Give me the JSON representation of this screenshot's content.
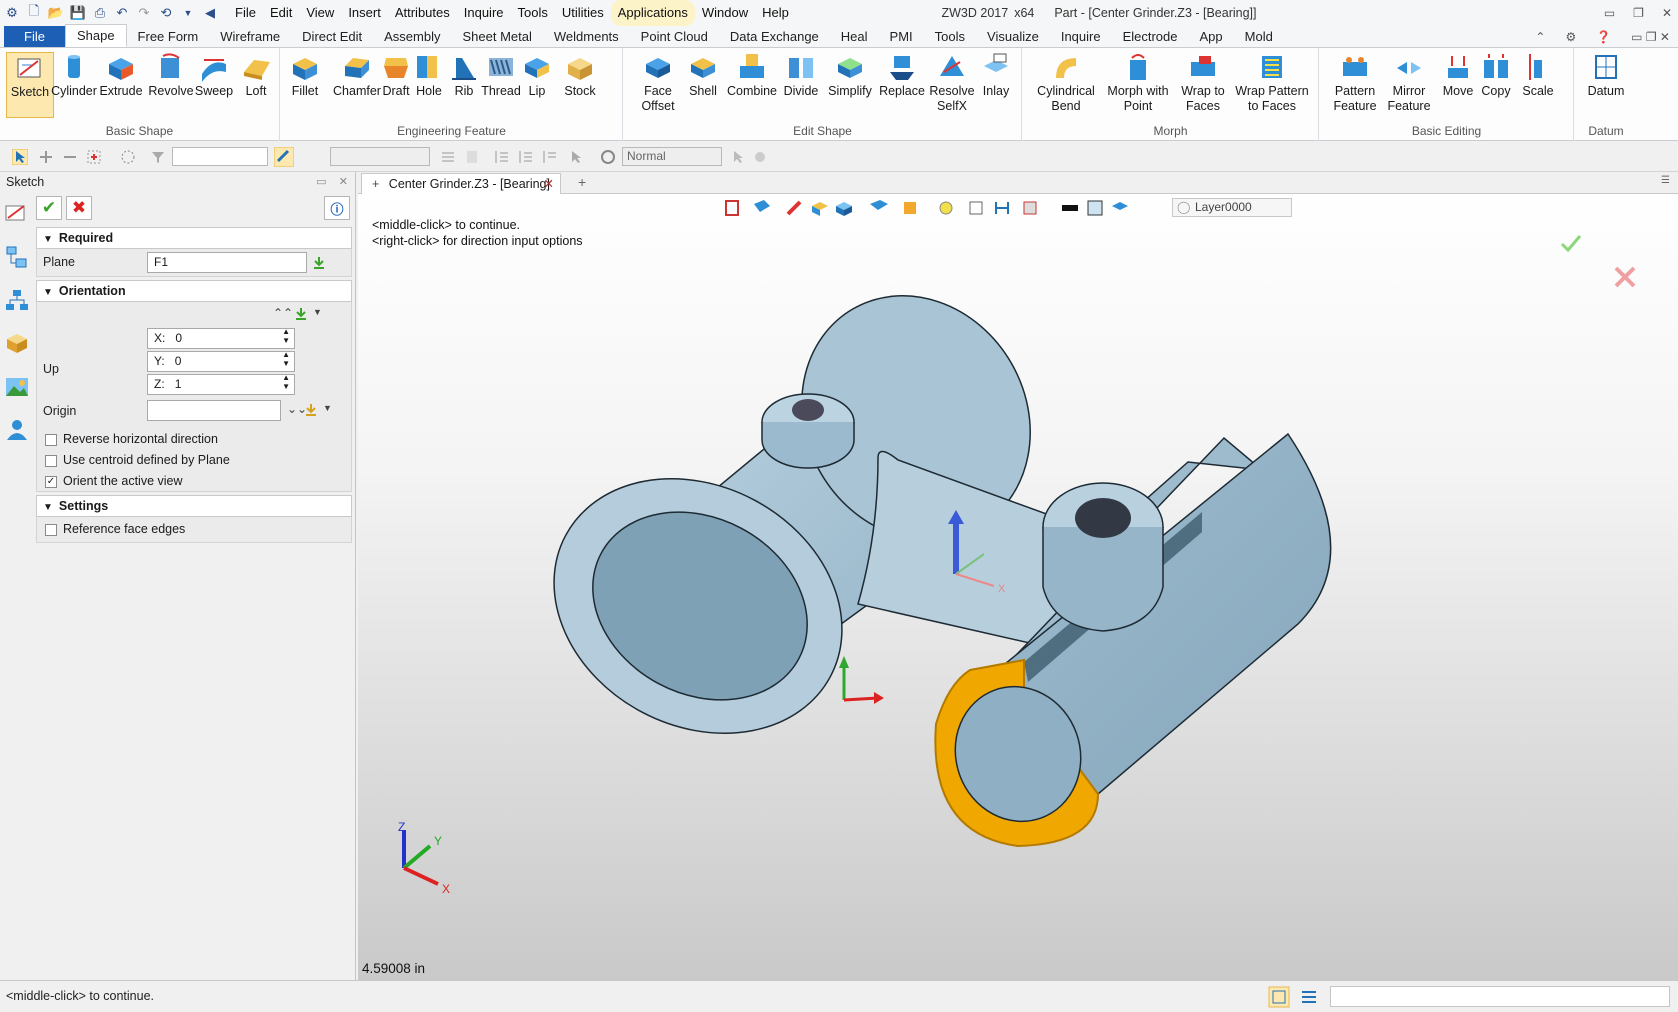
{
  "titlebar": {
    "app": "ZW3D 2017",
    "arch": "x64",
    "doc": "Part - [Center Grinder.Z3 - [Bearing]]"
  },
  "menu": [
    "File",
    "Edit",
    "View",
    "Insert",
    "Attributes",
    "Inquire",
    "Tools",
    "Utilities",
    "Applications",
    "Window",
    "Help"
  ],
  "ribbon_tabs": [
    "File",
    "Shape",
    "Free Form",
    "Wireframe",
    "Direct Edit",
    "Assembly",
    "Sheet Metal",
    "Weldments",
    "Point Cloud",
    "Data Exchange",
    "Heal",
    "PMI",
    "Tools",
    "Visualize",
    "Inquire",
    "Electrode",
    "App",
    "Mold"
  ],
  "active_tab": "Shape",
  "groups": {
    "basic_shape": {
      "title": "Basic Shape",
      "items": [
        "Sketch",
        "Cylinder",
        "Extrude",
        "Revolve",
        "Sweep",
        "Loft"
      ]
    },
    "engineering": {
      "title": "Engineering Feature",
      "items": [
        "Fillet",
        "Chamfer",
        "Draft",
        "Hole",
        "Rib",
        "Thread",
        "Lip",
        "Stock"
      ]
    },
    "edit_shape": {
      "title": "Edit Shape",
      "items": [
        "Face Offset",
        "Shell",
        "Combine",
        "Divide",
        "Simplify",
        "Replace",
        "Resolve SelfX",
        "Inlay"
      ]
    },
    "morph": {
      "title": "Morph",
      "items": [
        "Cylindrical Bend",
        "Morph with Point",
        "Wrap to Faces",
        "Wrap Pattern to Faces"
      ]
    },
    "basic_editing": {
      "title": "Basic Editing",
      "items": [
        "Pattern Feature",
        "Mirror Feature",
        "Move",
        "Copy",
        "Scale"
      ]
    },
    "datum": {
      "title": "Datum",
      "items": [
        "Datum"
      ]
    }
  },
  "toolbar2": {
    "render_mode": "Normal"
  },
  "panel": {
    "title": "Sketch",
    "required": {
      "title": "Required",
      "plane_label": "Plane",
      "plane_value": "F1"
    },
    "orientation": {
      "title": "Orientation",
      "up_label": "Up",
      "x_label": "X:",
      "x_value": "0",
      "y_label": "Y:",
      "y_value": "0",
      "z_label": "Z:",
      "z_value": "1",
      "origin_label": "Origin",
      "reverse_label": "Reverse horizontal direction",
      "reverse_checked": false,
      "centroid_label": "Use centroid defined by Plane",
      "centroid_checked": false,
      "orient_label": "Orient the active view",
      "orient_checked": true
    },
    "settings": {
      "title": "Settings",
      "ref_label": "Reference face edges",
      "ref_checked": false
    }
  },
  "doc_tab": {
    "label": "Center Grinder.Z3 - [Bearing]"
  },
  "viewport": {
    "prompt1": "<middle-click> to continue.",
    "prompt2": "<right-click> for direction input options",
    "layer": "Layer0000",
    "measure": "4.59008 in",
    "axis_x": "X",
    "axis_y": "Y",
    "axis_z": "Z"
  },
  "status": {
    "text": "<middle-click> to continue."
  },
  "colors": {
    "file_tab": "#1c5fb5",
    "model": "#a9c4d4",
    "highlight": "#f0a800",
    "accept": "#5cc43a",
    "cancel": "#e05050"
  }
}
